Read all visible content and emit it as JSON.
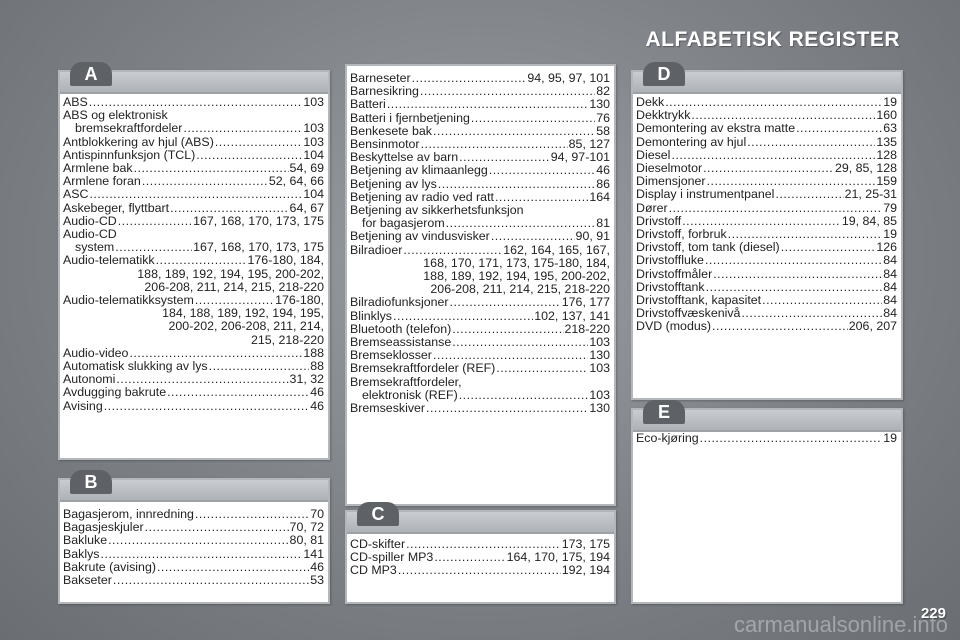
{
  "page_title": "ALFABETISK REGISTER",
  "page_number": "229",
  "watermark": "carmanualsonline.info",
  "sections": {
    "A": {
      "letter": "A",
      "entries": [
        {
          "text": "ABS",
          "pages": "103"
        },
        {
          "text": "ABS og elektronisk"
        },
        {
          "text": "bremsekraftfordeler",
          "pages": "103",
          "indent": true
        },
        {
          "text": "Antblokkering av hjul (ABS)",
          "pages": "103"
        },
        {
          "text": "Antispinnfunksjon (TCL)",
          "pages": "104"
        },
        {
          "text": "Armlene bak",
          "pages": "54, 69"
        },
        {
          "text": "Armlene foran",
          "pages": "52, 64, 66"
        },
        {
          "text": "ASC",
          "pages": "104"
        },
        {
          "text": "Askebeger, flyttbart",
          "pages": "64, 67"
        },
        {
          "text": "Audio-CD",
          "pages": "167, 168, 170, 173, 175"
        },
        {
          "text": "Audio-CD"
        },
        {
          "text": "system",
          "pages": "167, 168, 170, 173, 175",
          "indent": true
        },
        {
          "text": "Audio-telematikk",
          "pages": "176-180, 184,",
          "cont": [
            "188, 189, 192, 194, 195, 200-202,",
            "206-208, 211, 214, 215, 218-220"
          ]
        },
        {
          "text": "Audio-telematikksystem",
          "pages": "176-180,",
          "cont": [
            "184, 188, 189, 192, 194, 195,",
            "200-202, 206-208, 211, 214,",
            "215, 218-220"
          ]
        },
        {
          "text": "Audio-video",
          "pages": "188"
        },
        {
          "text": "Automatisk slukking av lys",
          "pages": "88"
        },
        {
          "text": "Autonomi",
          "pages": "31, 32"
        },
        {
          "text": "Avdugging bakrute",
          "pages": "46"
        },
        {
          "text": "Avising",
          "pages": "46"
        }
      ]
    },
    "B1": {
      "letter": "B",
      "entries": [
        {
          "text": "Bagasjerom, innredning",
          "pages": "70"
        },
        {
          "text": "Bagasjeskjuler",
          "pages": "70, 72"
        },
        {
          "text": "Bakluke",
          "pages": "80, 81"
        },
        {
          "text": "Baklys",
          "pages": "141"
        },
        {
          "text": "Bakrute (avising)",
          "pages": "46"
        },
        {
          "text": "Bakseter",
          "pages": "53"
        }
      ]
    },
    "B2": {
      "entries": [
        {
          "text": "Barneseter",
          "pages": "94, 95, 97, 101"
        },
        {
          "text": "Barnesikring",
          "pages": "82"
        },
        {
          "text": "Batteri",
          "pages": "130"
        },
        {
          "text": "Batteri i fjernbetjening",
          "pages": "76"
        },
        {
          "text": "Benkesete bak",
          "pages": "58"
        },
        {
          "text": "Bensinmotor",
          "pages": "85, 127"
        },
        {
          "text": "Beskyttelse av barn",
          "pages": "94, 97-101"
        },
        {
          "text": "Betjening av klimaanlegg",
          "pages": "46"
        },
        {
          "text": "Betjening av lys",
          "pages": "86"
        },
        {
          "text": "Betjening av radio ved ratt",
          "pages": "164"
        },
        {
          "text": "Betjening av sikkerhetsfunksjon"
        },
        {
          "text": "for bagasjerom",
          "pages": "81",
          "indent": true
        },
        {
          "text": "Betjening av vindusvisker",
          "pages": "90, 91"
        },
        {
          "text": "Bilradioer",
          "pages": "162, 164, 165, 167,",
          "cont": [
            "168, 170, 171, 173, 175-180, 184,",
            "188, 189, 192, 194, 195, 200-202,",
            "206-208, 211, 214, 215, 218-220"
          ]
        },
        {
          "text": "Bilradiofunksjoner",
          "pages": "176, 177"
        },
        {
          "text": "Blinklys",
          "pages": "102, 137, 141"
        },
        {
          "text": "Bluetooth (telefon)",
          "pages": "218-220"
        },
        {
          "text": "Bremseassistanse",
          "pages": "103"
        },
        {
          "text": "Bremseklosser",
          "pages": "130"
        },
        {
          "text": "Bremsekraftfordeler (REF)",
          "pages": "103"
        },
        {
          "text": "Bremsekraftfordeler,"
        },
        {
          "text": "elektronisk (REF)",
          "pages": "103",
          "indent": true
        },
        {
          "text": "Bremseskiver",
          "pages": "130"
        }
      ]
    },
    "C": {
      "letter": "C",
      "entries": [
        {
          "text": "CD-skifter",
          "pages": "173, 175"
        },
        {
          "text": "CD-spiller MP3",
          "pages": "164, 170, 175, 194"
        },
        {
          "text": "CD MP3",
          "pages": "192, 194"
        }
      ]
    },
    "D": {
      "letter": "D",
      "entries": [
        {
          "text": "Dekk",
          "pages": "19"
        },
        {
          "text": "Dekktrykk",
          "pages": "160"
        },
        {
          "text": "Demontering av ekstra matte",
          "pages": "63"
        },
        {
          "text": "Demontering av hjul",
          "pages": "135"
        },
        {
          "text": "Diesel",
          "pages": "128"
        },
        {
          "text": "Dieselmotor",
          "pages": "29, 85, 128"
        },
        {
          "text": "Dimensjoner",
          "pages": "159"
        },
        {
          "text": "Display i instrumentpanel",
          "pages": "21, 25-31"
        },
        {
          "text": "Dører",
          "pages": "79"
        },
        {
          "text": "Drivstoff",
          "pages": "19, 84, 85"
        },
        {
          "text": "Drivstoff, forbruk",
          "pages": "19"
        },
        {
          "text": "Drivstoff, tom tank (diesel)",
          "pages": "126"
        },
        {
          "text": "Drivstoffluke",
          "pages": "84"
        },
        {
          "text": "Drivstoffmåler",
          "pages": "84"
        },
        {
          "text": "Drivstofftank",
          "pages": "84"
        },
        {
          "text": "Drivstofftank, kapasitet",
          "pages": "84"
        },
        {
          "text": "Drivstoffvæskenivå",
          "pages": "84"
        },
        {
          "text": "DVD (modus)",
          "pages": "206, 207"
        }
      ]
    },
    "E": {
      "letter": "E",
      "entries": [
        {
          "text": "Eco-kjøring",
          "pages": "19"
        }
      ]
    }
  }
}
